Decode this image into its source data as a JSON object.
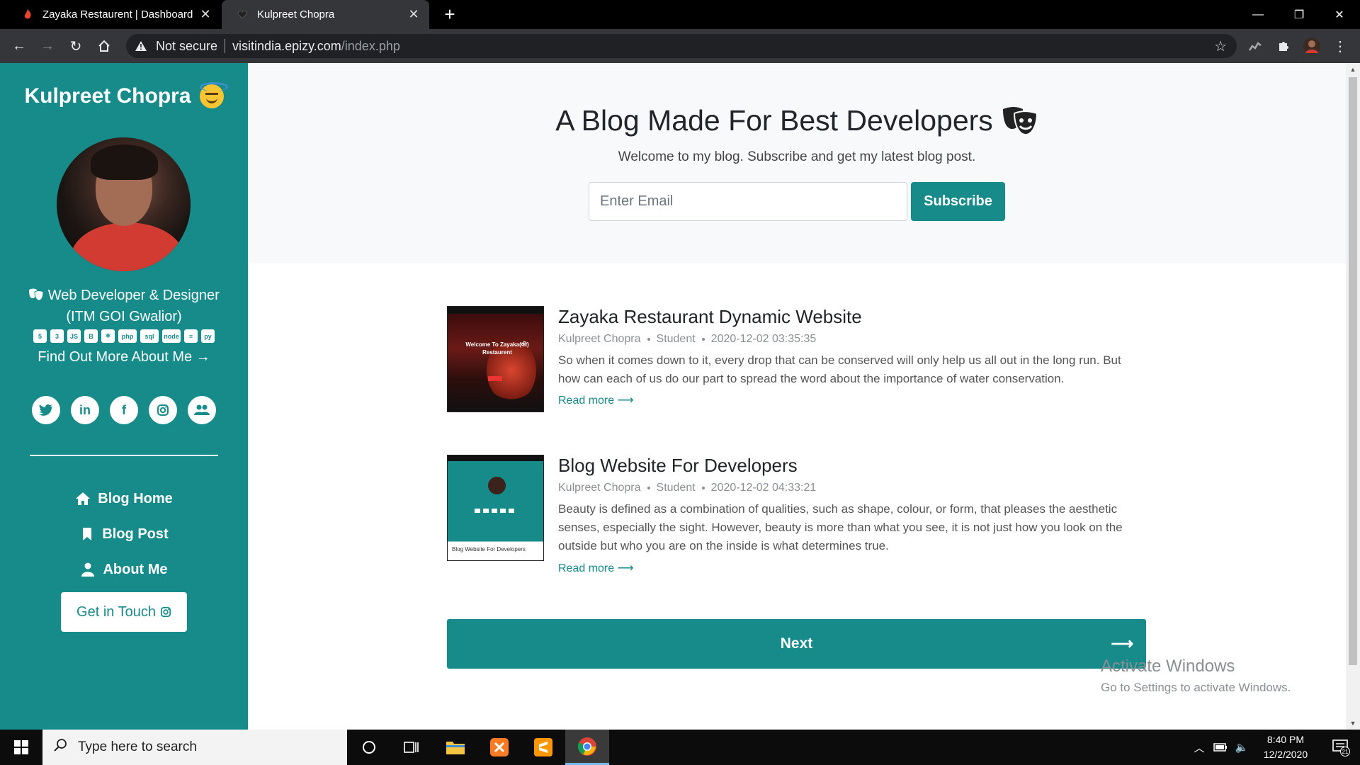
{
  "browser": {
    "tabs": [
      {
        "title": "Zayaka Restaurent | Dashboard",
        "active": false
      },
      {
        "title": "Kulpreet Chopra",
        "active": true
      }
    ],
    "security_label": "Not secure",
    "url_host": "visitindia.epizy.com",
    "url_path": "/index.php"
  },
  "sidebar": {
    "name": "Kulpreet Chopra",
    "role_line1": "Web Developer & Designer",
    "role_line2": "(ITM GOI Gwalior)",
    "tech_icons": [
      "html5-icon",
      "css3-icon",
      "js-icon",
      "bootstrap-icon",
      "react-icon",
      "php-icon",
      "mysql-icon",
      "node-icon",
      "database-icon",
      "python-icon"
    ],
    "find_more": "Find Out More About Me →",
    "socials": [
      "twitter-icon",
      "linkedin-icon",
      "facebook-icon",
      "instagram-icon",
      "users-icon"
    ],
    "nav": [
      {
        "label": "Blog Home",
        "icon": "home-icon"
      },
      {
        "label": "Blog Post",
        "icon": "bookmark-icon"
      },
      {
        "label": "About Me",
        "icon": "user-icon"
      }
    ],
    "cta": "Get in Touch"
  },
  "hero": {
    "title": "A Blog Made For Best Developers",
    "subtitle": "Welcome to my blog. Subscribe and get my latest blog post.",
    "email_placeholder": "Enter Email",
    "subscribe_label": "Subscribe"
  },
  "posts": [
    {
      "title": "Zayaka Restaurant Dynamic Website",
      "author": "Kulpreet Chopra",
      "role": "Student",
      "date": "2020-12-02 03:35:35",
      "excerpt": "So when it comes down to it, every drop that can be conserved will only help us all out in the long run. But how can each of us do our part to spread the word about the importance of water conservation.",
      "read_more": "Read more ⟶",
      "thumb_text": "Welcome To Zayaka(की) Restaurent"
    },
    {
      "title": "Blog Website For Developers",
      "author": "Kulpreet Chopra",
      "role": "Student",
      "date": "2020-12-02 04:33:21",
      "excerpt": "Beauty is defined as a combination of qualities, such as shape, colour, or form, that pleases the aesthetic senses, especially the sight. However, beauty is more than what you see, it is not just how you look on the outside but who you are on the inside is what determines true.",
      "read_more": "Read more ⟶",
      "thumb_text": "Blog Website For Developers"
    }
  ],
  "pagination": {
    "next_label": "Next"
  },
  "watermark": {
    "line1": "Activate Windows",
    "line2": "Go to Settings to activate Windows."
  },
  "taskbar": {
    "search_placeholder": "Type here to search",
    "time": "8:40 PM",
    "date": "12/2/2020",
    "notification_count": "21"
  },
  "colors": {
    "accent": "#178a8a"
  }
}
